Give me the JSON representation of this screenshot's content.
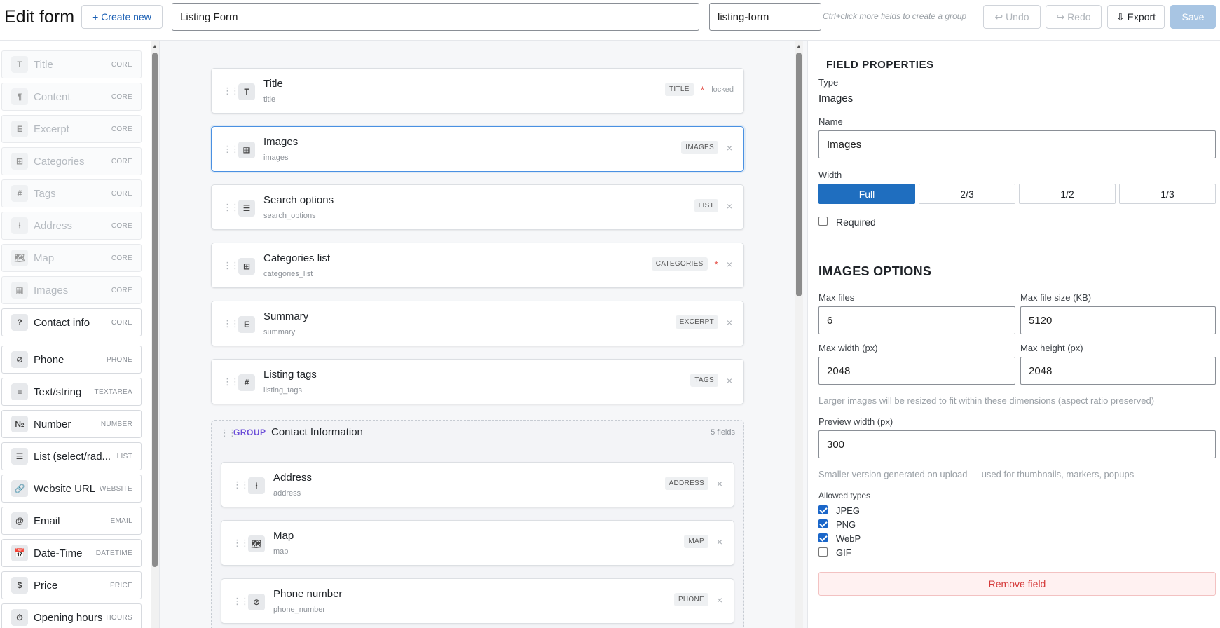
{
  "header": {
    "title": "Edit form",
    "create_label": "+ Create new",
    "form_name": "Listing Form",
    "form_slug": "listing-form",
    "hint": "Ctrl+click more fields to create a group",
    "undo_label": "↩ Undo",
    "redo_label": "↪ Redo",
    "export_label": "⇩ Export",
    "save_label": "Save"
  },
  "palette": {
    "items": [
      {
        "icon": "T",
        "label": "Title",
        "tag": "CORE"
      },
      {
        "icon": "¶",
        "label": "Content",
        "tag": "CORE"
      },
      {
        "icon": "E",
        "label": "Excerpt",
        "tag": "CORE"
      },
      {
        "icon": "⊞",
        "label": "Categories",
        "tag": "CORE"
      },
      {
        "icon": "#",
        "label": "Tags",
        "tag": "CORE"
      },
      {
        "icon": "⍿",
        "label": "Address",
        "tag": "CORE"
      },
      {
        "icon": "🗺",
        "label": "Map",
        "tag": "CORE"
      },
      {
        "icon": "▦",
        "label": "Images",
        "tag": "CORE"
      },
      {
        "icon": "?",
        "label": "Contact info",
        "tag": "CORE"
      },
      {
        "icon": "⊘",
        "label": "Phone",
        "tag": "PHONE"
      },
      {
        "icon": "≡",
        "label": "Text/string",
        "tag": "TEXTAREA"
      },
      {
        "icon": "№",
        "label": "Number",
        "tag": "NUMBER"
      },
      {
        "icon": "☰",
        "label": "List (select/rad...",
        "tag": "LIST"
      },
      {
        "icon": "🔗",
        "label": "Website URL",
        "tag": "WEBSITE"
      },
      {
        "icon": "@",
        "label": "Email",
        "tag": "EMAIL"
      },
      {
        "icon": "📅",
        "label": "Date-Time",
        "tag": "DATETIME"
      },
      {
        "icon": "$",
        "label": "Price",
        "tag": "PRICE"
      },
      {
        "icon": "⏱",
        "label": "Opening hours",
        "tag": "HOURS"
      }
    ]
  },
  "canvas": {
    "fields": [
      {
        "icon": "T",
        "label": "Title",
        "key": "title",
        "badge": "TITLE",
        "required": "*",
        "locked": "locked"
      },
      {
        "icon": "▦",
        "label": "Images",
        "key": "images",
        "badge": "IMAGES",
        "remove": "×"
      },
      {
        "icon": "☰",
        "label": "Search options",
        "key": "search_options",
        "badge": "LIST",
        "remove": "×"
      },
      {
        "icon": "⊞",
        "label": "Categories list",
        "key": "categories_list",
        "badge": "CATEGORIES",
        "required": "*",
        "remove": "×"
      },
      {
        "icon": "E",
        "label": "Summary",
        "key": "summary",
        "badge": "EXCERPT",
        "remove": "×"
      },
      {
        "icon": "#",
        "label": "Listing tags",
        "key": "listing_tags",
        "badge": "TAGS",
        "remove": "×"
      }
    ],
    "group": {
      "keyword": "GROUP",
      "title": "Contact Information",
      "count": "5 fields",
      "fields": [
        {
          "icon": "⍿",
          "label": "Address",
          "key": "address",
          "badge": "ADDRESS",
          "remove": "×"
        },
        {
          "icon": "🗺",
          "label": "Map",
          "key": "map",
          "badge": "MAP",
          "remove": "×"
        },
        {
          "icon": "⊘",
          "label": "Phone number",
          "key": "phone_number",
          "badge": "PHONE",
          "remove": "×"
        }
      ]
    }
  },
  "properties": {
    "heading": "FIELD PROPERTIES",
    "type_label": "Type",
    "type_value": "Images",
    "name_label": "Name",
    "name_value": "Images",
    "width_label": "Width",
    "width_options": [
      "Full",
      "2/3",
      "1/2",
      "1/3"
    ],
    "width_selected": "Full",
    "required_label": "Required",
    "required_checked": false,
    "section_title": "IMAGES OPTIONS",
    "max_files_label": "Max files",
    "max_files": "6",
    "max_size_label": "Max file size (KB)",
    "max_size": "5120",
    "max_width_label": "Max width (px)",
    "max_width": "2048",
    "max_height_label": "Max height (px)",
    "max_height": "2048",
    "resize_hint": "Larger images will be resized to fit within these dimensions (aspect ratio preserved)",
    "preview_label": "Preview width (px)",
    "preview_width": "300",
    "preview_hint": "Smaller version generated on upload — used for thumbnails, markers, popups",
    "allowed_label": "Allowed types",
    "types": [
      {
        "label": "JPEG",
        "checked": true
      },
      {
        "label": "PNG",
        "checked": true
      },
      {
        "label": "WebP",
        "checked": true
      },
      {
        "label": "GIF",
        "checked": false
      }
    ],
    "remove_label": "Remove field"
  },
  "colors": {
    "accent": "#1f6ebf",
    "selected_border": "#4a90e2",
    "group_keyword": "#6a4cd8",
    "danger": "#d53a3a"
  }
}
